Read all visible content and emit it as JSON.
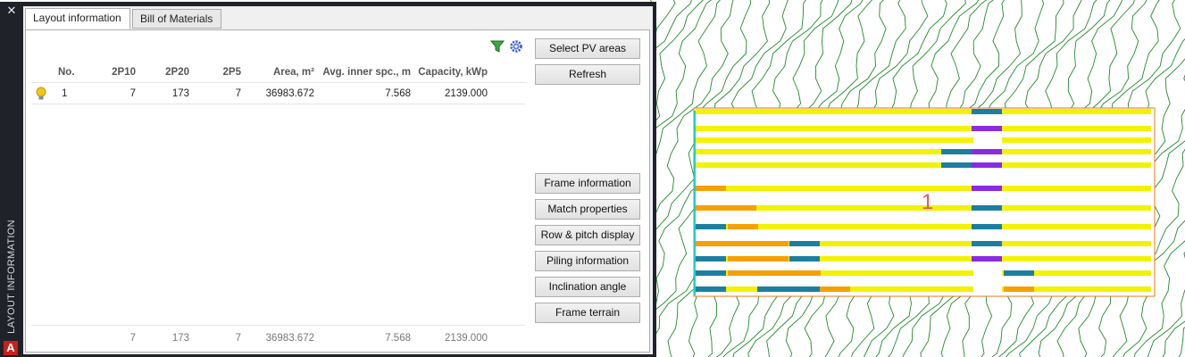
{
  "palette": {
    "vertical_title": "LAYOUT INFORMATION",
    "close_glyph": "✕",
    "app_icon_letter": "A"
  },
  "tabs": [
    {
      "label": "Layout information",
      "active": true
    },
    {
      "label": "Bill of Materials",
      "active": false
    }
  ],
  "toolbar_icons": [
    "filter-icon",
    "settings-gear-icon"
  ],
  "table": {
    "headers": {
      "no": "No.",
      "p10": "2P10",
      "p20": "2P20",
      "p5": "2P5",
      "area": "Area, m²",
      "spacing": "Avg. inner spc., m",
      "capacity": "Capacity, kWp"
    },
    "rows": [
      {
        "icon": "lightbulb-icon",
        "no": "1",
        "p10": "7",
        "p20": "173",
        "p5": "7",
        "area": "36983.672",
        "spacing": "7.568",
        "capacity": "2139.000"
      }
    ],
    "totals": {
      "p10": "7",
      "p20": "173",
      "p5": "7",
      "area": "36983.672",
      "spacing": "7.568",
      "capacity": "2139.000"
    }
  },
  "buttons": {
    "select_pv_areas": "Select PV areas",
    "refresh": "Refresh",
    "frame_information": "Frame information",
    "match_properties": "Match properties",
    "row_pitch_display": "Row & pitch display",
    "piling_information": "Piling information",
    "inclination_angle": "Inclination angle",
    "frame_terrain": "Frame terrain"
  },
  "drawing": {
    "area_label": "1",
    "colors": {
      "contour": "#1f8a2a",
      "boundary": "#27c9c9",
      "outline": "#e07b18",
      "row_main": "#f2f200",
      "row_blue": "#1c7fa0",
      "row_purple": "#8a2be2",
      "row_orange": "#f5a000",
      "label": "#e05a5a"
    }
  }
}
